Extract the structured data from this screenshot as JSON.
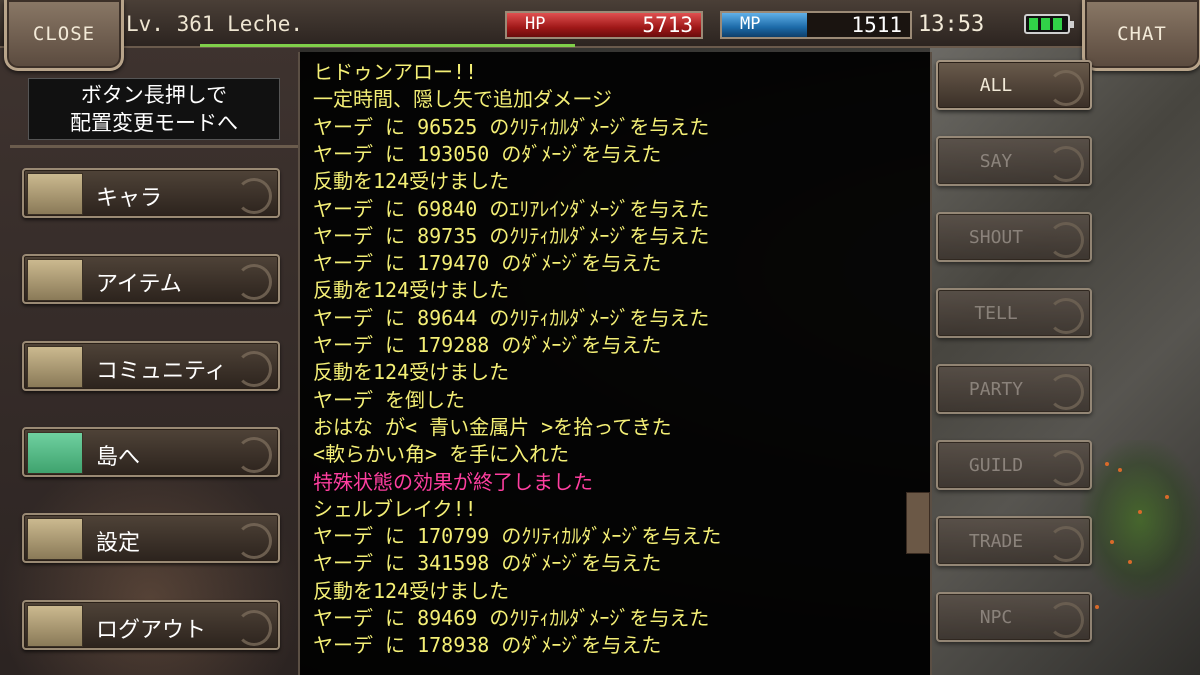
{
  "topbar": {
    "close_label": "CLOSE",
    "chat_label": "CHAT",
    "level_text": "Lv. 361 Leche.",
    "hp_label": "HP",
    "hp_value": "5713",
    "hp_fill": 1.0,
    "mp_label": "MP",
    "mp_value": "1511",
    "mp_fill": 0.45,
    "clock": "13:53",
    "battery_icon": "battery-full-icon"
  },
  "menu": {
    "hint_line1": "ボタン長押しで",
    "hint_line2": "配置変更モードへ",
    "items": [
      {
        "label": "キャラ",
        "icon": "character-icon"
      },
      {
        "label": "アイテム",
        "icon": "item-icon"
      },
      {
        "label": "コミュニティ",
        "icon": "community-icon"
      },
      {
        "label": "島へ",
        "icon": "island-icon"
      },
      {
        "label": "設定",
        "icon": "settings-icon"
      },
      {
        "label": "ログアウト",
        "icon": "logout-icon"
      }
    ]
  },
  "chat": {
    "lines": [
      {
        "text": "ヒドゥンアロー!!",
        "color": "#f4ef76"
      },
      {
        "text": "一定時間、隠し矢で追加ダメージ",
        "color": "#f4ef76"
      },
      {
        "text": "ヤーデ に 96525 のｸﾘﾃｨｶﾙﾀﾞﾒｰｼﾞを与えた",
        "color": "#f4ef76"
      },
      {
        "text": "ヤーデ に 193050 のﾀﾞﾒｰｼﾞを与えた",
        "color": "#f4ef76"
      },
      {
        "text": "反動を124受けました",
        "color": "#f4ef76"
      },
      {
        "text": "ヤーデ に 69840 のｴﾘｱﾚｲﾝﾀﾞﾒｰｼﾞを与えた",
        "color": "#f4ef76"
      },
      {
        "text": "ヤーデ に 89735 のｸﾘﾃｨｶﾙﾀﾞﾒｰｼﾞを与えた",
        "color": "#f4ef76"
      },
      {
        "text": "ヤーデ に 179470 のﾀﾞﾒｰｼﾞを与えた",
        "color": "#f4ef76"
      },
      {
        "text": "反動を124受けました",
        "color": "#f4ef76"
      },
      {
        "text": "ヤーデ に 89644 のｸﾘﾃｨｶﾙﾀﾞﾒｰｼﾞを与えた",
        "color": "#f4ef76"
      },
      {
        "text": "ヤーデ に 179288 のﾀﾞﾒｰｼﾞを与えた",
        "color": "#f4ef76"
      },
      {
        "text": "反動を124受けました",
        "color": "#f4ef76"
      },
      {
        "text": "ヤーデ を倒した",
        "color": "#f4ef76"
      },
      {
        "text": "おはな が< 青い金属片 >を拾ってきた",
        "color": "#f4ef76"
      },
      {
        "text": "<軟らかい角> を手に入れた",
        "color": "#f4ef76"
      },
      {
        "text": "特殊状態の効果が終了しました",
        "color": "#ff3fa0"
      },
      {
        "text": "シェルブレイク!!",
        "color": "#f4ef76"
      },
      {
        "text": "ヤーデ に 170799 のｸﾘﾃｨｶﾙﾀﾞﾒｰｼﾞを与えた",
        "color": "#f4ef76"
      },
      {
        "text": "ヤーデ に 341598 のﾀﾞﾒｰｼﾞを与えた",
        "color": "#f4ef76"
      },
      {
        "text": "反動を124受けました",
        "color": "#f4ef76"
      },
      {
        "text": "ヤーデ に 89469 のｸﾘﾃｨｶﾙﾀﾞﾒｰｼﾞを与えた",
        "color": "#f4ef76"
      },
      {
        "text": "ヤーデ に 178938 のﾀﾞﾒｰｼﾞを与えた",
        "color": "#f4ef76"
      }
    ]
  },
  "channels": [
    {
      "label": "ALL",
      "active": true
    },
    {
      "label": "SAY",
      "active": false
    },
    {
      "label": "SHOUT",
      "active": false
    },
    {
      "label": "TELL",
      "active": false
    },
    {
      "label": "PARTY",
      "active": false
    },
    {
      "label": "GUILD",
      "active": false
    },
    {
      "label": "TRADE",
      "active": false
    },
    {
      "label": "NPC",
      "active": false
    }
  ]
}
